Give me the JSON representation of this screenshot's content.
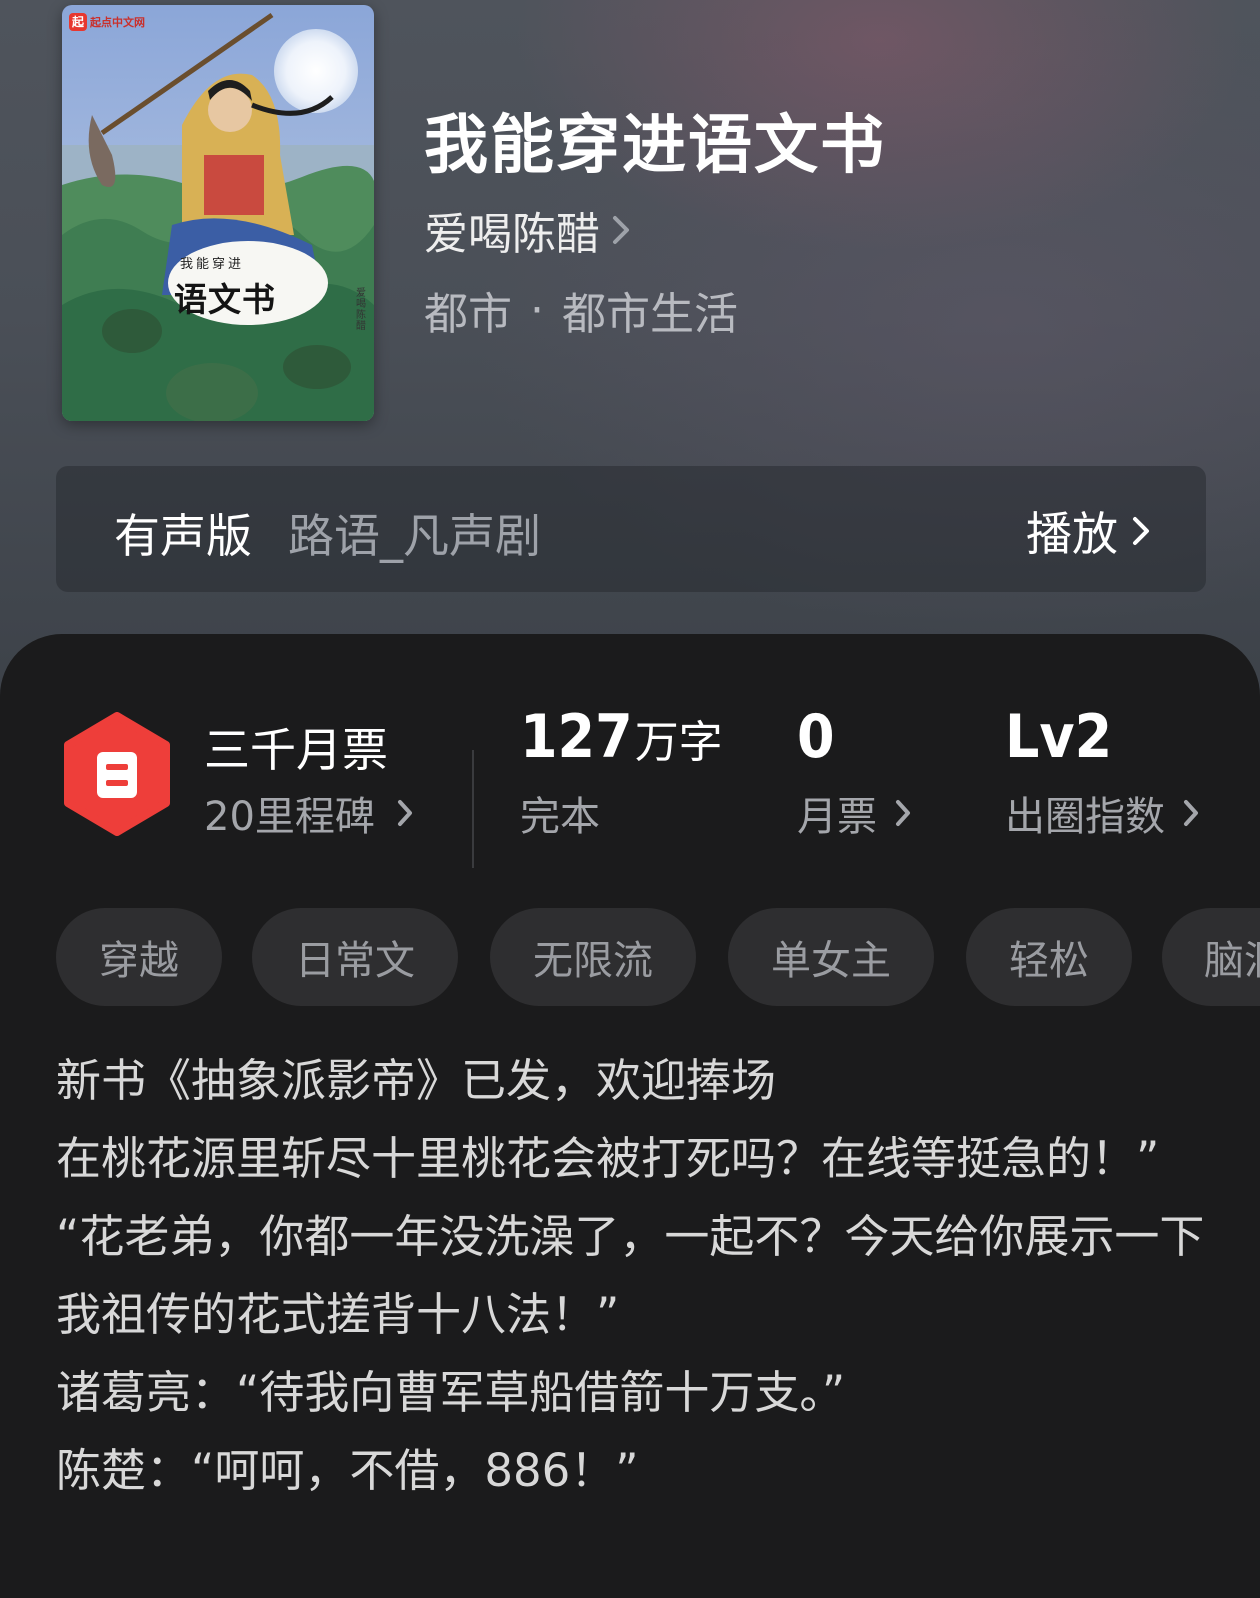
{
  "cover": {
    "brand": "起点中文网",
    "brand_badge": "起",
    "top_text": "我能穿进",
    "title_text": "语文书",
    "author_text": "爱喝陈醋"
  },
  "book": {
    "title": "我能穿进语文书",
    "author": "爱喝陈醋",
    "category": "都市",
    "subcategory": "都市生活",
    "separator": "·"
  },
  "audio": {
    "label": "有声版",
    "narrator": "路语_凡声剧",
    "play": "播放"
  },
  "stats": {
    "ticket_title": "三千月票",
    "ticket_sub": "20里程碑",
    "word_count": "127",
    "word_unit": "万字",
    "status": "完本",
    "votes": "0",
    "votes_label": "月票",
    "level": "Lv2",
    "level_label": "出圈指数"
  },
  "tags": [
    "穿越",
    "日常文",
    "无限流",
    "单女主",
    "轻松",
    "脑洞"
  ],
  "intro": [
    "新书《抽象派影帝》已发，欢迎捧场",
    "在桃花源里斩尽十里桃花会被打死吗？在线等挺急的！”",
    "“花老弟，你都一年没洗澡了，一起不？今天给你展示一下我祖传的花式搓背十八法！”",
    "诸葛亮：“待我向曹军草船借箭十万支。”",
    "陈楚：“呵呵，不借，886！”"
  ],
  "colors": {
    "hero_top": "#4f545c",
    "panel_bg": "#1b1b1c",
    "tag_bg": "#2e2e30",
    "badge_red": "#ee3e3a",
    "muted_text": "#a4a6ab"
  },
  "icons": {
    "chevron": "chevron-right-icon",
    "ticket": "ticket-icon"
  }
}
